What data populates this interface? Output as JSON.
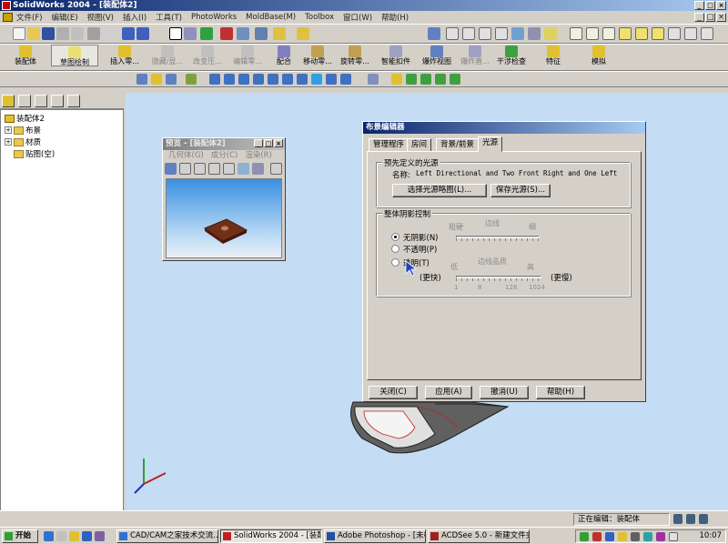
{
  "window": {
    "title": "SolidWorks 2004 - [装配体2]"
  },
  "menu": [
    "文件(F)",
    "编辑(E)",
    "视图(V)",
    "插入(I)",
    "工具(T)",
    "PhotoWorks",
    "MoldBase(M)",
    "Toolbox",
    "窗口(W)",
    "帮助(H)"
  ],
  "command_bar": [
    "装配体",
    "草图绘制",
    "插入零...",
    "隐藏/显...",
    "改变压...",
    "编辑零...",
    "配合",
    "移动零...",
    "旋转零...",
    "智能扣件",
    "爆炸视图",
    "爆炸直...",
    "干涉检查",
    "特征",
    "模拟"
  ],
  "tree": {
    "root": "装配体2",
    "items": [
      {
        "label": "布景",
        "expander": "+"
      },
      {
        "label": "材质",
        "expander": "+"
      },
      {
        "label": "贴图(空)",
        "expander": ""
      }
    ]
  },
  "preview": {
    "title": "预览 - [装配体2]",
    "menu": [
      "几何体(G)",
      "成分(C)",
      "渲染(R)"
    ]
  },
  "dialog": {
    "title": "布景编辑器",
    "tabs": [
      "管理程序",
      "房间",
      "背景/前景",
      "光源"
    ],
    "active_tab": 3,
    "preset_group": "预先定义的光源",
    "name_label": "名称:",
    "name_value": "Left Directional and Two Front Right and One Left",
    "choose_btn": "选择光源略图(L)...",
    "save_btn": "保存光源(S)...",
    "shadow_group": "整体阴影控制",
    "slider1_labels": [
      "粗硬",
      "边线",
      "细"
    ],
    "radios": [
      "无阴影(N)",
      "不透明(P)",
      "透明(T)"
    ],
    "radio_selected": 0,
    "quality_label": "边线品质",
    "low": "低",
    "high": "高",
    "faster": "(更快)",
    "slower": "(更慢)",
    "scale": [
      "1",
      "8",
      "128",
      "1024"
    ],
    "buttons": [
      "关闭(C)",
      "应用(A)",
      "撤消(U)",
      "帮助(H)"
    ]
  },
  "status": {
    "text": "正在编辑：装配体"
  },
  "taskbar": {
    "start": "开始",
    "items": [
      "CAD/CAM之家技术交流...",
      "SolidWorks 2004 - [装配...",
      "Adobe Photoshop - [未标...",
      "ACDSee 5.0 - 新建文件夹"
    ],
    "active": 1,
    "clock": "10:07"
  },
  "colors": {
    "titlebar": "#0a246a",
    "viewport": "#c4dcf4",
    "chrome": "#d4d0c8"
  }
}
